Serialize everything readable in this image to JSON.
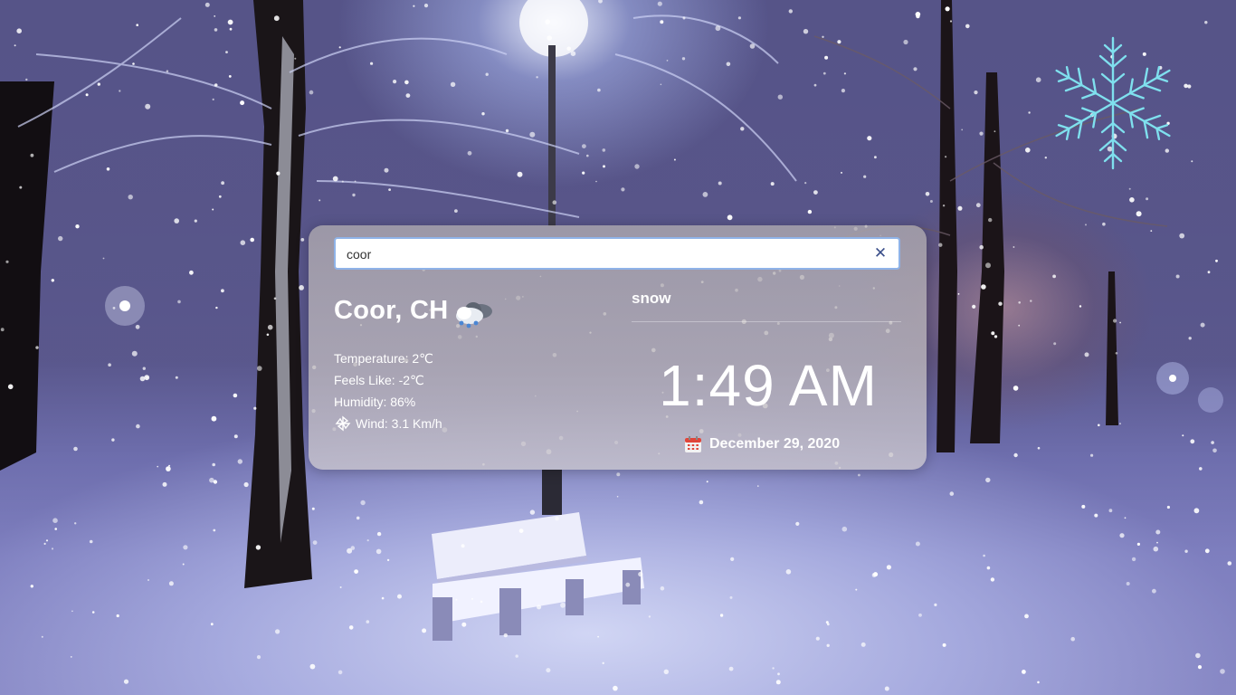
{
  "search": {
    "value": "coor"
  },
  "location": {
    "city": "Coor, CH"
  },
  "details": {
    "temperature": "Temperature: 2℃",
    "feels_like": "Feels Like: -2℃",
    "humidity": "Humidity: 86%",
    "wind": "Wind: 3.1 Km/h"
  },
  "condition": "snow",
  "clock": "1:49 AM",
  "date": "December 29, 2020",
  "icons": {
    "weather": "cloud-snow-icon",
    "wind": "pinwheel-icon",
    "calendar": "calendar-icon",
    "clear": "close-icon",
    "snowflake": "snowflake-icon"
  },
  "colors": {
    "snowflake": "#7fe0ee",
    "clear_button": "#3b4f8a",
    "search_border": "#8fb3e8"
  }
}
